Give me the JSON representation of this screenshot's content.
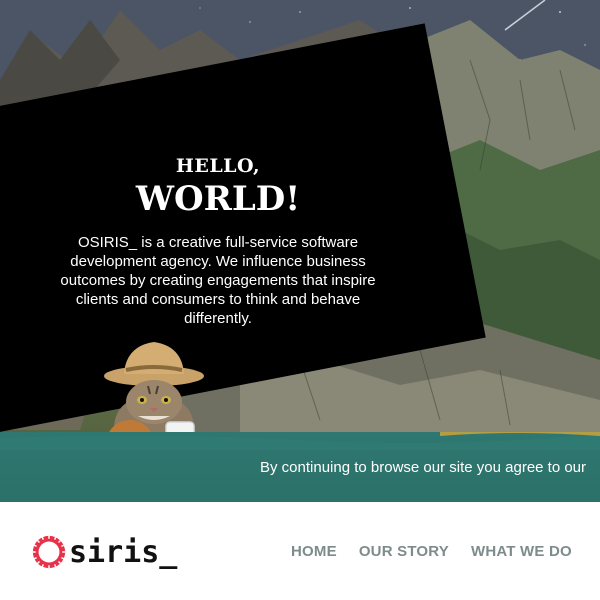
{
  "hero": {
    "greeting_small": "HELLO,",
    "greeting_large": "WORLD!",
    "description": "OSIRIS_ is a creative full-service software development agency. We influence business outcomes by creating engagements that inspire clients and consumers to think and behave differently."
  },
  "cookie_banner": {
    "text": "By continuing to browse our site you agree to our"
  },
  "header": {
    "logo_text": "siris_",
    "nav": [
      {
        "label": "HOME"
      },
      {
        "label": "OUR STORY"
      },
      {
        "label": "WHAT WE DO"
      }
    ]
  },
  "icons": {
    "logo": "osiris-gear-logo-icon",
    "mascot": "cat-with-cookie-and-milk"
  },
  "colors": {
    "card": "#000000",
    "cookie_bar": "#2f7771",
    "nav": "#7d8c8b",
    "logo_ring": "#e8324a"
  }
}
